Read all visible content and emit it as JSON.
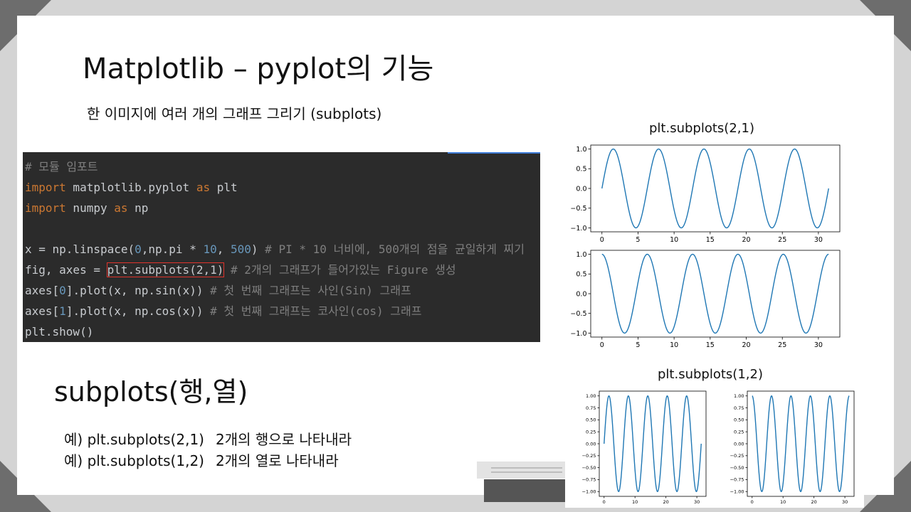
{
  "slide": {
    "title": "Matplotlib – pyplot의 기능",
    "subtitle": "한 이미지에 여러 개의 그래프 그리기 (subplots)"
  },
  "code": {
    "lines": [
      [
        {
          "t": "# 모듈 임포트",
          "c": "cmt"
        }
      ],
      [
        {
          "t": "import",
          "c": "kw"
        },
        {
          "t": " matplotlib.pyplot "
        },
        {
          "t": "as",
          "c": "kw"
        },
        {
          "t": " plt"
        }
      ],
      [
        {
          "t": "import",
          "c": "kw"
        },
        {
          "t": " numpy "
        },
        {
          "t": "as",
          "c": "kw"
        },
        {
          "t": " np"
        }
      ],
      [],
      [
        {
          "t": "x = np.linspace("
        },
        {
          "t": "0",
          "c": "num"
        },
        {
          "t": ",np.pi * "
        },
        {
          "t": "10",
          "c": "num"
        },
        {
          "t": ", "
        },
        {
          "t": "500",
          "c": "num"
        },
        {
          "t": ") "
        },
        {
          "t": "# PI * 10 너비에, 500개의 점을 균일하게 찌기",
          "c": "cmt"
        }
      ],
      [
        {
          "t": "fig, axes = "
        },
        {
          "t": "plt.subplots(2,1)",
          "c": "hl"
        },
        {
          "t": " "
        },
        {
          "t": "# 2개의 그래프가 들어가있는 Figure 생성",
          "c": "cmt"
        }
      ],
      [
        {
          "t": "axes["
        },
        {
          "t": "0",
          "c": "num"
        },
        {
          "t": "].plot(x, np.sin(x)) "
        },
        {
          "t": "# 첫 번째 그래프는 사인(Sin) 그래프",
          "c": "cmt"
        }
      ],
      [
        {
          "t": "axes["
        },
        {
          "t": "1",
          "c": "num"
        },
        {
          "t": "].plot(x, np.cos(x)) "
        },
        {
          "t": "# 첫 번째 그래프는 코사인(cos) 그래프",
          "c": "cmt"
        }
      ],
      [
        {
          "t": "plt.show()"
        }
      ]
    ]
  },
  "section": {
    "heading": "subplots(행,열)",
    "examples": [
      {
        "prefix": "예)",
        "call": "plt.subplots(2,1)",
        "desc": "2개의 행으로 나타내라"
      },
      {
        "prefix": "예)",
        "call": "plt.subplots(1,2)",
        "desc": "2개의 열로 나타내라"
      }
    ]
  },
  "plots": {
    "label_21": "plt.subplots(2,1)",
    "label_12": "plt.subplots(1,2)"
  },
  "colors": {
    "line": "#1f77b4",
    "code_bg": "#2b2b2b",
    "keyword": "#cc7832",
    "number": "#6897bb",
    "comment": "#7f7f7f",
    "highlight_box": "#e0332c"
  },
  "chart_data": [
    {
      "type": "line",
      "function": "sin",
      "x_range": [
        0,
        31.4159
      ],
      "n_points": 500,
      "xticks": [
        0,
        5,
        10,
        15,
        20,
        25,
        30
      ],
      "yticks": [
        -1.0,
        -0.5,
        0.0,
        0.5,
        1.0
      ],
      "ytick_labels": [
        "−1.0",
        "−0.5",
        "0.0",
        "0.5",
        "1.0"
      ],
      "ylim": [
        -1.1,
        1.1
      ]
    },
    {
      "type": "line",
      "function": "cos",
      "x_range": [
        0,
        31.4159
      ],
      "n_points": 500,
      "xticks": [
        0,
        5,
        10,
        15,
        20,
        25,
        30
      ],
      "yticks": [
        -1.0,
        -0.5,
        0.0,
        0.5,
        1.0
      ],
      "ytick_labels": [
        "−1.0",
        "−0.5",
        "0.0",
        "0.5",
        "1.0"
      ],
      "ylim": [
        -1.1,
        1.1
      ]
    },
    {
      "type": "line",
      "function": "sin",
      "x_range": [
        0,
        31.4159
      ],
      "n_points": 500,
      "xticks": [
        0,
        10,
        20,
        30
      ],
      "yticks": [
        -1.0,
        -0.75,
        -0.5,
        -0.25,
        0.0,
        0.25,
        0.5,
        0.75,
        1.0
      ],
      "ytick_labels": [
        "−1.00",
        "−0.75",
        "−0.50",
        "−0.25",
        "0.00",
        "0.25",
        "0.50",
        "0.75",
        "1.00"
      ],
      "ylim": [
        -1.1,
        1.1
      ]
    },
    {
      "type": "line",
      "function": "cos",
      "x_range": [
        0,
        31.4159
      ],
      "n_points": 500,
      "xticks": [
        0,
        10,
        20,
        30
      ],
      "yticks": [
        -1.0,
        -0.75,
        -0.5,
        -0.25,
        0.0,
        0.25,
        0.5,
        0.75,
        1.0
      ],
      "ytick_labels": [
        "−1.00",
        "−0.75",
        "−0.50",
        "−0.25",
        "0.00",
        "0.25",
        "0.50",
        "0.75",
        "1.00"
      ],
      "ylim": [
        -1.1,
        1.1
      ]
    }
  ]
}
